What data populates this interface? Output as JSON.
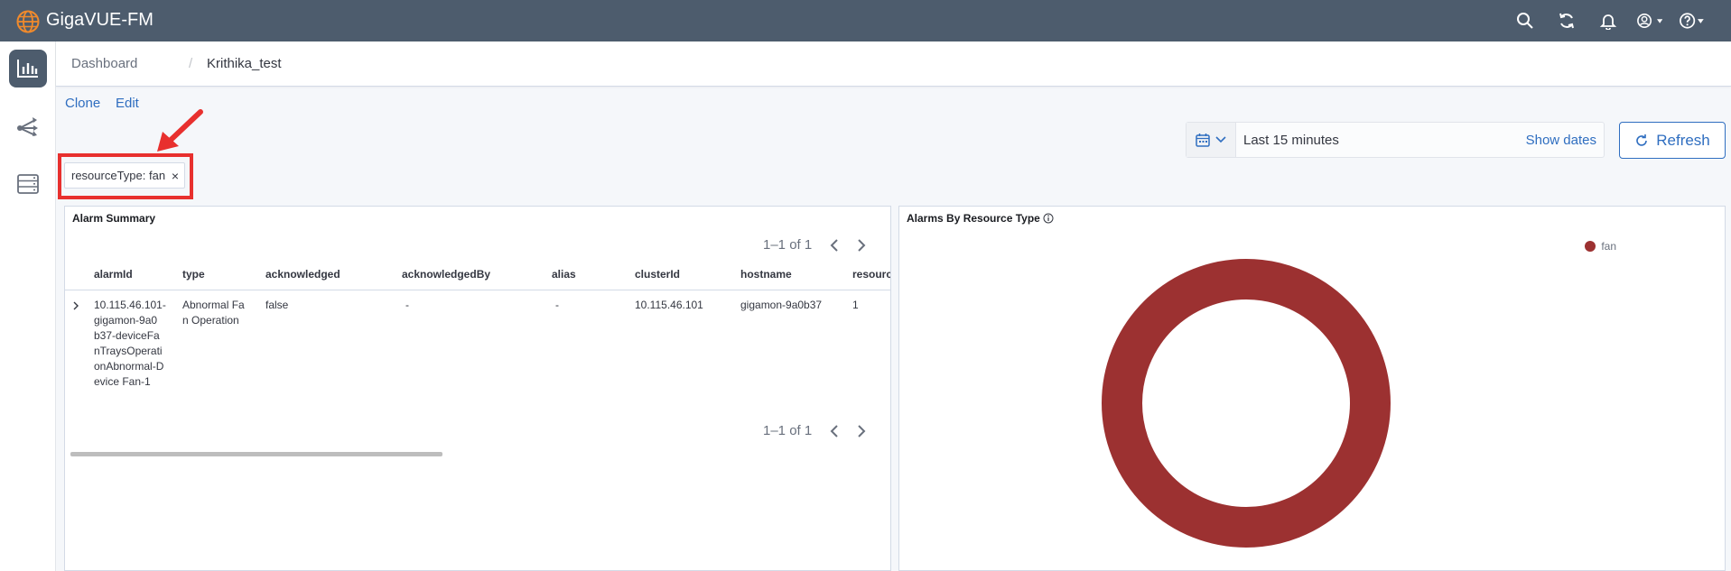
{
  "app": {
    "title": "GigaVUE-FM"
  },
  "header_icons": [
    "search-icon",
    "sync-icon",
    "bell-icon",
    "user-icon",
    "help-icon"
  ],
  "breadcrumb": {
    "root": "Dashboard",
    "separator": "/",
    "current": "Krithika_test"
  },
  "actions": {
    "clone": "Clone",
    "edit": "Edit"
  },
  "date_picker": {
    "range": "Last 15 minutes",
    "show_dates": "Show dates"
  },
  "refresh": {
    "label": "Refresh"
  },
  "filter": {
    "label": "resourceType: fan",
    "remove": "×"
  },
  "alarm_summary": {
    "title": "Alarm Summary",
    "pager": "1–1 of 1",
    "columns": [
      "alarmId",
      "type",
      "acknowledged",
      "acknowledgedBy",
      "alias",
      "clusterId",
      "hostname",
      "resourc"
    ],
    "row": {
      "alarmId": [
        "10.115.46.101-",
        "gigamon-9a0",
        "b37-deviceFa",
        "nTraysOperati",
        "onAbnormal-D",
        "evice Fan-1"
      ],
      "type": [
        "Abnormal Fa",
        "n Operation"
      ],
      "acknowledged": "false",
      "acknowledgedBy": "-",
      "alias": "-",
      "clusterId": "10.115.46.101",
      "hostname": "gigamon-9a0b37",
      "resource": "1"
    }
  },
  "alarms_by_type": {
    "title": "Alarms By Resource Type",
    "legend": "fan"
  },
  "chart_data": {
    "type": "pie",
    "title": "Alarms By Resource Type",
    "slices": [
      {
        "label": "fan",
        "value": 1,
        "color": "#9c3131"
      }
    ]
  },
  "colors": {
    "topbar": "#4d5c6d",
    "accent": "#2f6ec0",
    "highlight": "#e8302e",
    "fan": "#9c3131"
  }
}
